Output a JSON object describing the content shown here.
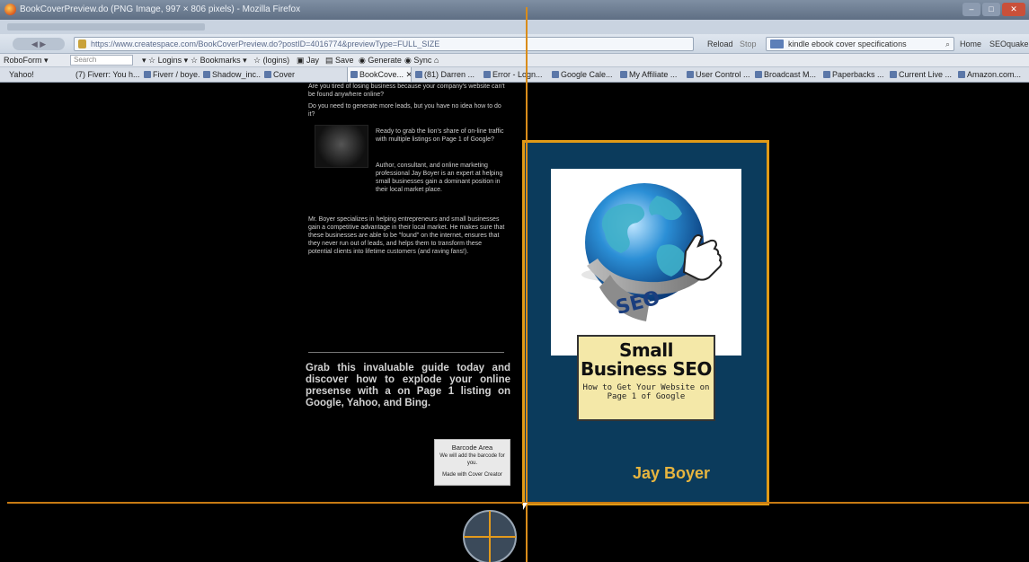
{
  "window": {
    "title": "BookCoverPreview.do (PNG Image, 997 × 806 pixels) - Mozilla Firefox"
  },
  "navbar": {
    "back_label": "",
    "url": "https://www.createspace.com/BookCoverPreview.do?postID=4016774&previewType=FULL_SIZE",
    "reload_label": "Reload",
    "stop_label": "Stop",
    "search_value": "kindle ebook cover specifications",
    "home_label": "Home",
    "seo_label": "SEOquake"
  },
  "roboform": {
    "brand": "RoboForm",
    "search_placeholder": "Search",
    "items": [
      "Logins",
      "Bookmarks",
      "(logins)",
      "Jay",
      "Save",
      "Generate",
      "Sync"
    ]
  },
  "bookmarks": [
    {
      "label": "Yahoo!",
      "active": false
    },
    {
      "label": "(7) Fiverr: You h...",
      "active": false
    },
    {
      "label": "Fiverr / boye...",
      "active": false
    },
    {
      "label": "Shadow_inc...",
      "active": false
    },
    {
      "label": "Cover",
      "active": false
    },
    {
      "label": "BookCove...",
      "active": true
    },
    {
      "label": "(81) Darren ...",
      "active": false
    },
    {
      "label": "Error - Logn...",
      "active": false
    },
    {
      "label": "Google Cale...",
      "active": false
    },
    {
      "label": "My Affiliate ...",
      "active": false
    },
    {
      "label": "User Control ...",
      "active": false
    },
    {
      "label": "Broadcast M...",
      "active": false
    },
    {
      "label": "Paperbacks ...",
      "active": false
    },
    {
      "label": "Current Live ...",
      "active": false
    },
    {
      "label": "Amazon.com...",
      "active": false
    }
  ],
  "back_cover": {
    "p1": "Are you tired of losing business because your company's website can't be found anywhere online?",
    "p2": "Do you need to generate more leads, but you have no idea how to do it?",
    "p3": "Ready to grab the lion's share of on-line traffic with multiple listings on Page 1 of Google?",
    "p4": "Author, consultant, and online marketing professional Jay Boyer is an expert at helping small businesses gain a dominant position in their local market place.",
    "p5": "",
    "p6": "Mr. Boyer specializes in helping entrepreneurs and small businesses gain a competitive advantage in their local market. He makes sure that these businesses are able to be \"found\" on the internet, ensures that they never run out of leads, and helps them to transform these potential clients into lifetime customers (and raving fans!).",
    "cta": "Grab this invaluable guide today and discover how to explode your online presense with a on Page 1 listing on Google, Yahoo, and Bing."
  },
  "barcode": {
    "title": "Barcode Area",
    "note": "We will add the barcode for you.",
    "credit": "Made with Cover Creator"
  },
  "front_cover": {
    "art_label": "SEO",
    "title_line1": "Small",
    "title_line2": "Business SEO",
    "subtitle": "How to Get Your Website on Page 1 of Google",
    "author": "Jay Boyer",
    "colors": {
      "background": "#0b3b5c",
      "border": "#e19a16",
      "title_box": "#f4e8a8",
      "author": "#e7b53f"
    }
  }
}
